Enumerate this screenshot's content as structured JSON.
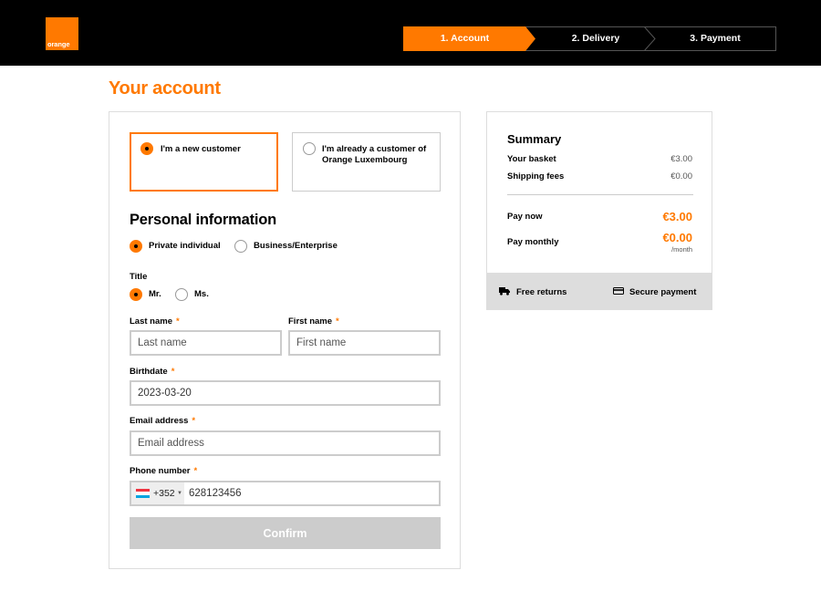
{
  "header": {
    "logo_text": "orange",
    "steps": [
      {
        "label": "1. Account",
        "active": true
      },
      {
        "label": "2. Delivery",
        "active": false
      },
      {
        "label": "3. Payment",
        "active": false
      }
    ]
  },
  "page_title": "Your account",
  "customer_type": {
    "options": [
      {
        "label": "I'm a new customer",
        "selected": true
      },
      {
        "label": "I'm already a customer of Orange Luxembourg",
        "selected": false
      }
    ]
  },
  "personal_info": {
    "title": "Personal information",
    "account_type": {
      "options": [
        {
          "label": "Private individual",
          "selected": true
        },
        {
          "label": "Business/Enterprise",
          "selected": false
        }
      ]
    },
    "title_field": {
      "label": "Title",
      "options": [
        {
          "label": "Mr.",
          "selected": true
        },
        {
          "label": "Ms.",
          "selected": false
        }
      ]
    },
    "last_name": {
      "label": "Last name",
      "required": "*",
      "placeholder": "Last name",
      "value": ""
    },
    "first_name": {
      "label": "First name",
      "required": "*",
      "placeholder": "First name",
      "value": ""
    },
    "birthdate": {
      "label": "Birthdate",
      "required": "*",
      "value": "2023-03-20"
    },
    "email": {
      "label": "Email address",
      "required": "*",
      "placeholder": "Email address",
      "value": ""
    },
    "phone": {
      "label": "Phone number",
      "required": "*",
      "prefix": "+352",
      "value": "628123456"
    },
    "confirm_label": "Confirm"
  },
  "summary": {
    "title": "Summary",
    "basket_label": "Your basket",
    "basket_value": "€3.00",
    "shipping_label": "Shipping fees",
    "shipping_value": "€0.00",
    "pay_now_label": "Pay now",
    "pay_now_value": "€3.00",
    "pay_monthly_label": "Pay monthly",
    "pay_monthly_value": "€0.00",
    "per_month": "/month",
    "free_returns": "Free returns",
    "secure_payment": "Secure payment"
  },
  "colors": {
    "brand_orange": "#ff7900",
    "header_bg": "#000000",
    "disabled_button": "#cccccc"
  },
  "icons": [
    "truck-icon",
    "credit-card-icon",
    "luxembourg-flag-icon",
    "chevron-down-icon"
  ]
}
